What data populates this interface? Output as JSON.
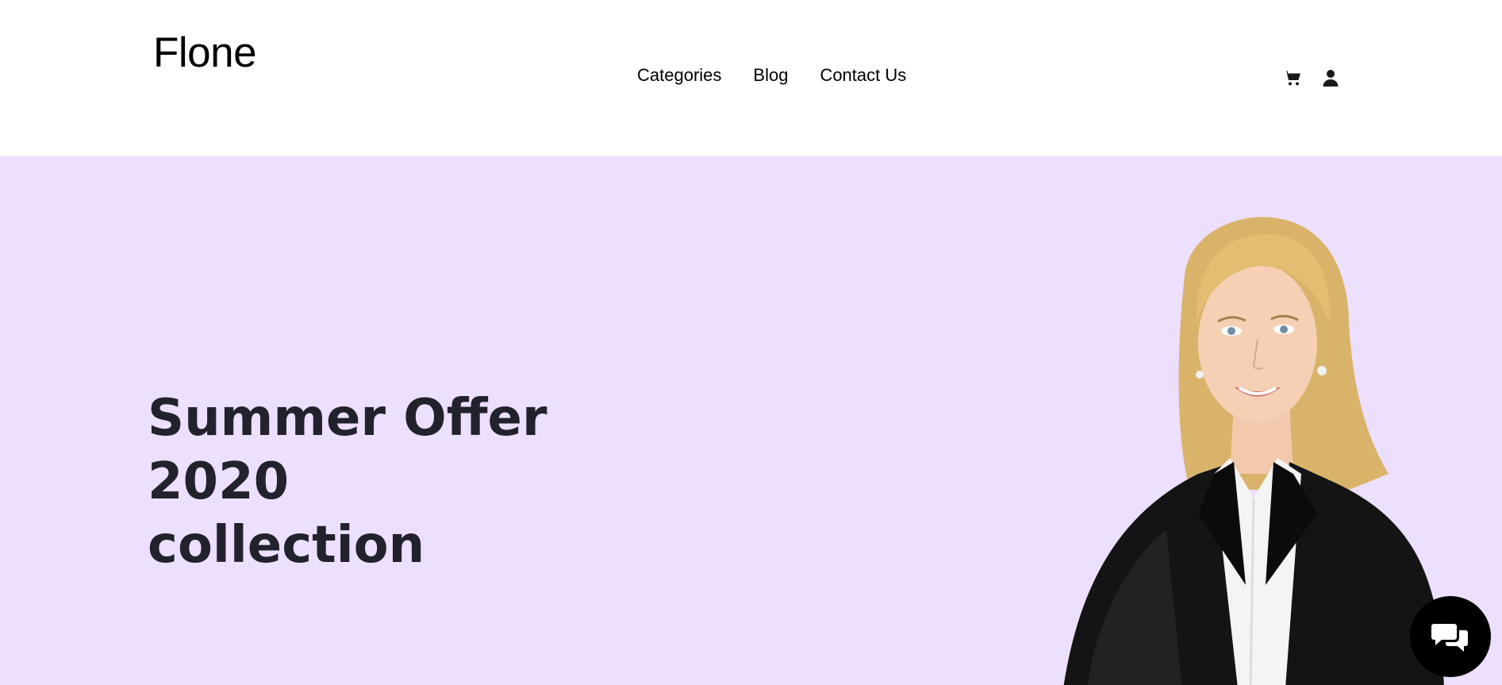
{
  "header": {
    "logo": "Flone",
    "nav": [
      {
        "label": "Categories"
      },
      {
        "label": "Blog"
      },
      {
        "label": "Contact Us"
      }
    ],
    "icons": [
      "cart-icon",
      "user-icon"
    ]
  },
  "hero": {
    "title_line1": "Summer Offer 2020",
    "title_line2": "collection",
    "background": "#eddffe"
  },
  "chat": {
    "icon": "chat-bubbles-icon"
  }
}
